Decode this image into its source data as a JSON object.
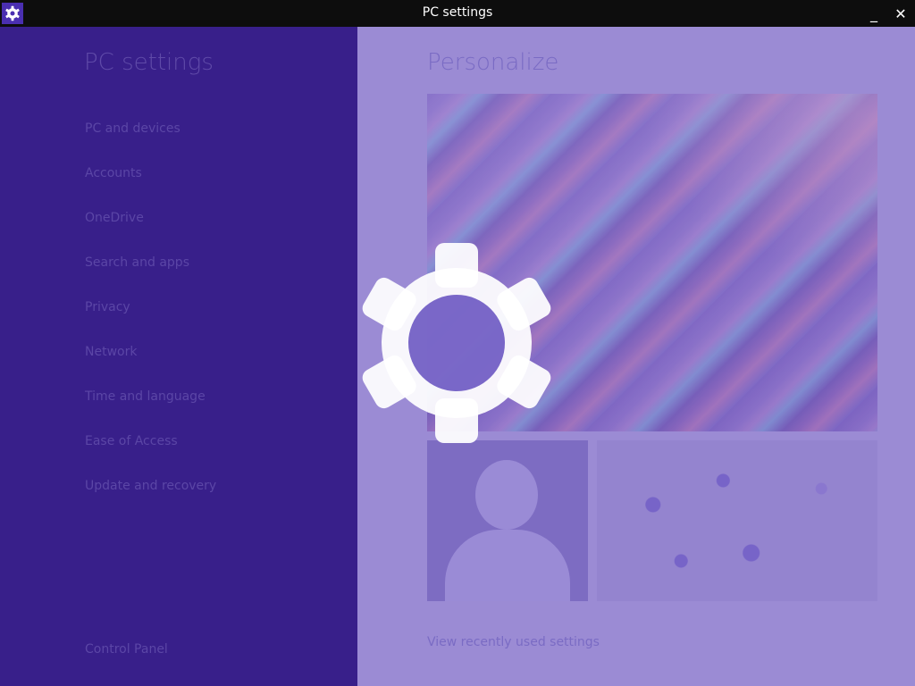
{
  "window": {
    "title": "PC settings",
    "minimize_label": "_",
    "close_label": "✕"
  },
  "sidebar": {
    "title": "PC settings",
    "items": [
      {
        "label": "PC and devices"
      },
      {
        "label": "Accounts"
      },
      {
        "label": "OneDrive"
      },
      {
        "label": "Search and apps"
      },
      {
        "label": "Privacy"
      },
      {
        "label": "Network"
      },
      {
        "label": "Time and language"
      },
      {
        "label": "Ease of Access"
      },
      {
        "label": "Update and recovery"
      }
    ],
    "control_panel_label": "Control Panel"
  },
  "main": {
    "title": "Personalize",
    "recent_link": "View recently used settings"
  },
  "colors": {
    "accent": "#381f8a",
    "panel": "#9b8bd4",
    "titlebar": "#0d0d0d"
  },
  "icons": {
    "app": "gear-icon",
    "splash": "gear-icon",
    "avatar": "person-icon"
  }
}
